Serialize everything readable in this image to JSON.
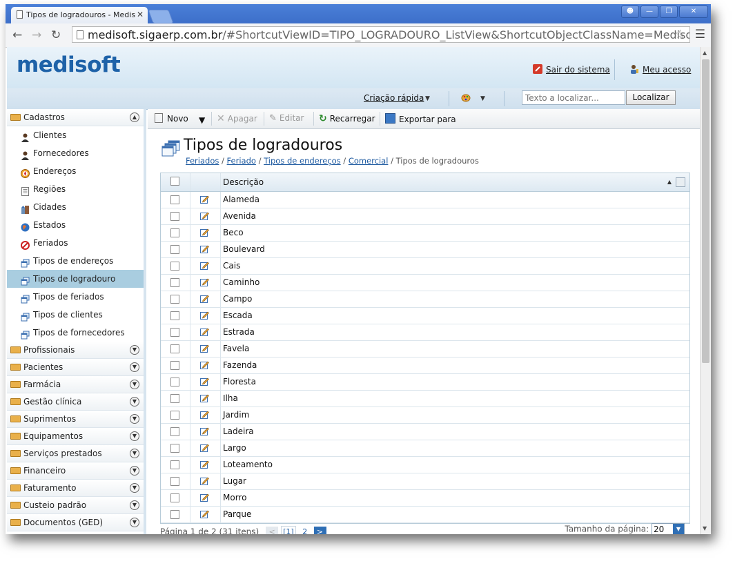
{
  "browser": {
    "tab_title": "Tipos de logradouros - Medis",
    "tab_close": "✕",
    "url_host": "medisoft.sigaerp.com.br",
    "url_path": "/#ShortcutViewID=TIPO_LOGRADOURO_ListView&ShortcutObjectClassName=Medisoft.Module"
  },
  "header": {
    "logo": "medisoft",
    "logout": "Sair do sistema",
    "my_access": "Meu acesso",
    "quick_create": "Criação rápida",
    "search_placeholder": "Texto a localizar...",
    "search_button": "Localizar"
  },
  "sidebar": {
    "open_group": "Cadastros",
    "items": [
      {
        "label": "Clientes",
        "icon": "person-icon"
      },
      {
        "label": "Fornecedores",
        "icon": "person-icon"
      },
      {
        "label": "Endereços",
        "icon": "compass-icon"
      },
      {
        "label": "Regiões",
        "icon": "list-icon"
      },
      {
        "label": "Cidades",
        "icon": "city-icon"
      },
      {
        "label": "Estados",
        "icon": "globe-icon"
      },
      {
        "label": "Feriados",
        "icon": "holiday-icon"
      },
      {
        "label": "Tipos de endereços",
        "icon": "windows-icon"
      },
      {
        "label": "Tipos de logradouro",
        "icon": "windows-icon"
      },
      {
        "label": "Tipos de feriados",
        "icon": "windows-icon"
      },
      {
        "label": "Tipos de clientes",
        "icon": "windows-icon"
      },
      {
        "label": "Tipos de fornecedores",
        "icon": "windows-icon"
      }
    ],
    "selected_index": 8,
    "groups": [
      "Profissionais",
      "Pacientes",
      "Farmácia",
      "Gestão clínica",
      "Suprimentos",
      "Equipamentos",
      "Serviços prestados",
      "Financeiro",
      "Faturamento",
      "Custeio padrão",
      "Documentos (GED)"
    ]
  },
  "toolbar": {
    "new": "Novo",
    "delete": "Apagar",
    "edit": "Editar",
    "reload": "Recarregar",
    "export": "Exportar para"
  },
  "page": {
    "title": "Tipos de logradouros",
    "breadcrumb_links": [
      "Feriados",
      "Feriado",
      "Tipos de endereços",
      "Comercial"
    ],
    "breadcrumb_current": "Tipos de logradouros"
  },
  "grid": {
    "column": "Descrição",
    "rows": [
      "Alameda",
      "Avenida",
      "Beco",
      "Boulevard",
      "Cais",
      "Caminho",
      "Campo",
      "Escada",
      "Estrada",
      "Favela",
      "Fazenda",
      "Floresta",
      "Ilha",
      "Jardim",
      "Ladeira",
      "Largo",
      "Loteamento",
      "Lugar",
      "Morro",
      "Parque"
    ]
  },
  "pager": {
    "summary": "Página 1 de 2 (31 itens)",
    "current_page": "[1]",
    "next_page": "2",
    "page_size_label": "Tamanho da página:",
    "page_size": "20"
  },
  "colors": {
    "brand": "#1e62a8",
    "selected_item": "#a9cde0",
    "link": "#1e5aa0"
  }
}
